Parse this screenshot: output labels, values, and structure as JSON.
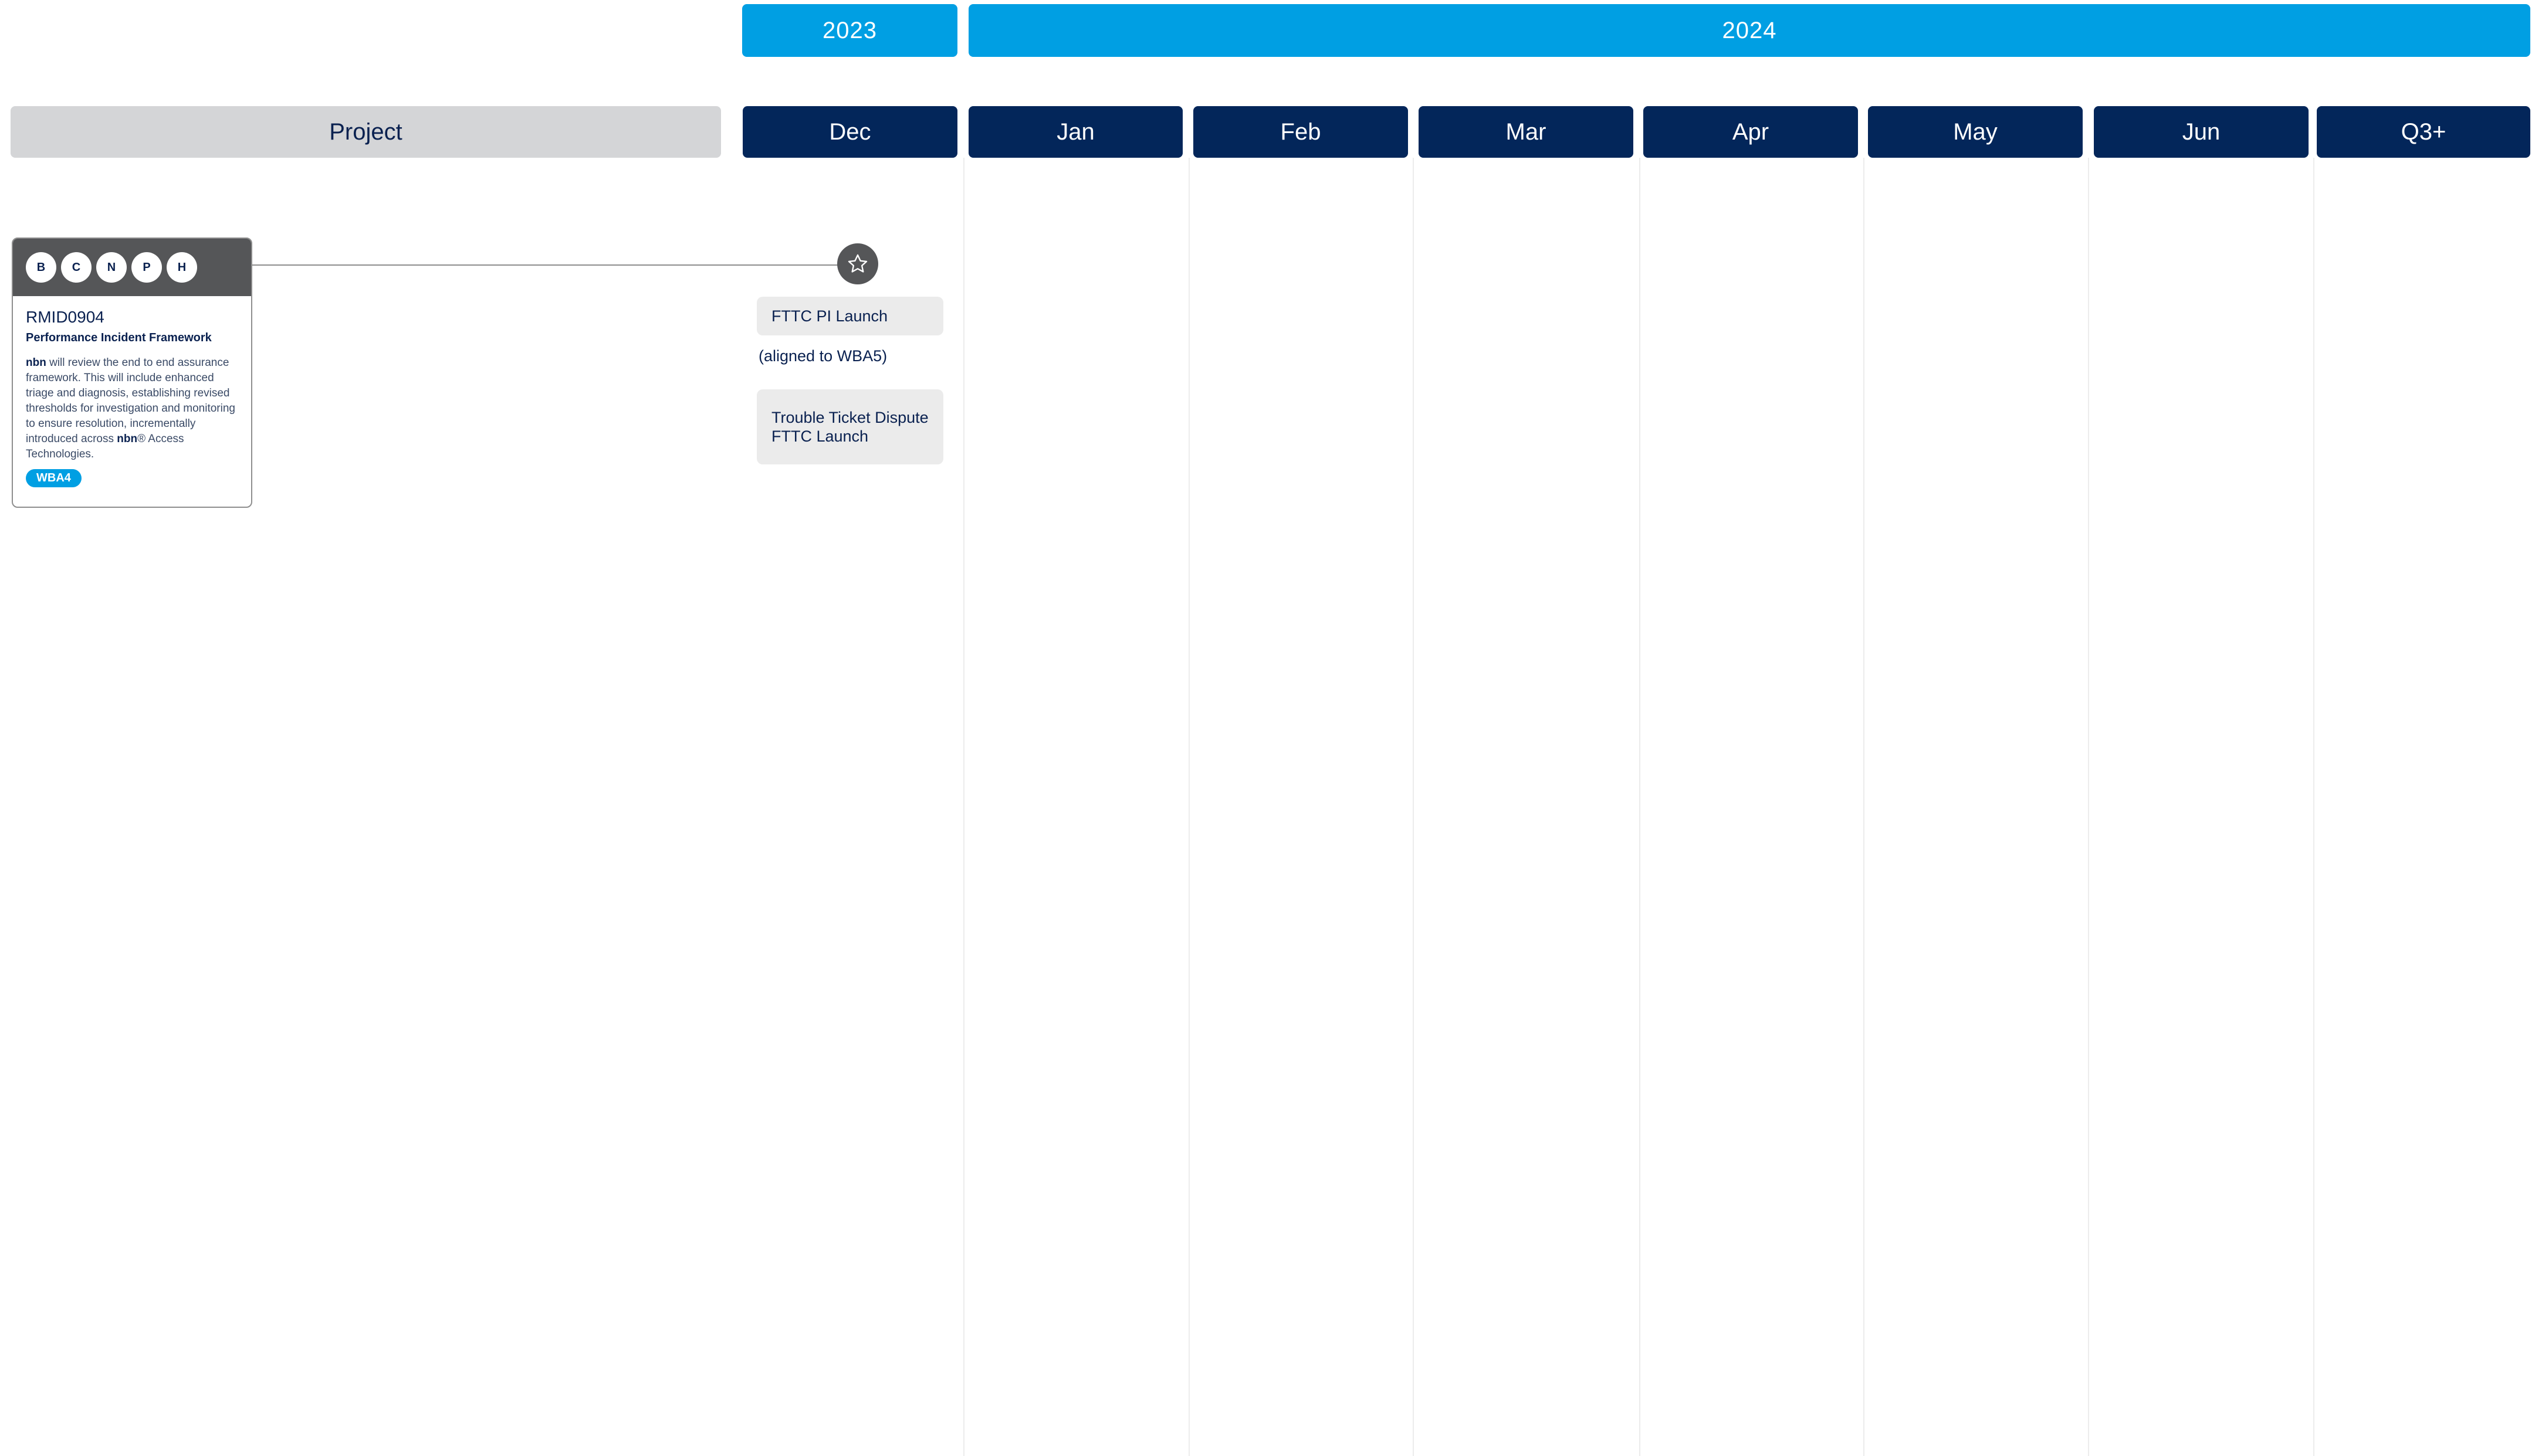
{
  "years": [
    {
      "label": "2023"
    },
    {
      "label": "2024"
    }
  ],
  "header": {
    "project_label": "Project",
    "months": [
      "Dec",
      "Jan",
      "Feb",
      "Mar",
      "Apr",
      "May",
      "Jun",
      "Q3+"
    ]
  },
  "project_card": {
    "badges": [
      "B",
      "C",
      "N",
      "P",
      "H"
    ],
    "id": "RMID0904",
    "title": "Performance Incident Framework",
    "desc_brand": "nbn",
    "desc_text": " will review the end to end assurance framework. This will include enhanced triage and diagnosis, establishing revised thresholds for investigation and monitoring to ensure resolution, incrementally introduced across ",
    "desc_brand2": "nbn",
    "desc_tail": "® Access Technologies.",
    "tag": "WBA4"
  },
  "milestone": {
    "icon": "star-icon",
    "items": [
      "FTTC PI Launch",
      "(aligned to WBA5)",
      "Trouble Ticket Dispute FTTC Launch"
    ]
  },
  "colors": {
    "year_blue": "#009fe3",
    "month_navy": "#03265a",
    "project_grey": "#d4d5d7",
    "card_header": "#555658"
  }
}
